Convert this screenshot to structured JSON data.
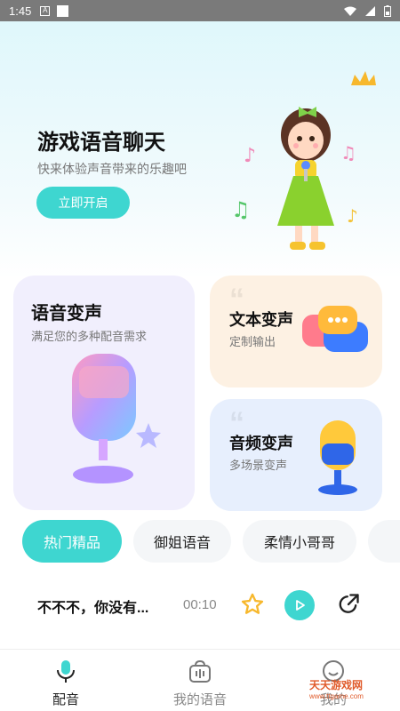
{
  "status_bar": {
    "time": "1:45"
  },
  "hero": {
    "title": "游戏语音聊天",
    "subtitle": "快来体验声音带来的乐趣吧",
    "button_label": "立即开启"
  },
  "cards": [
    {
      "title": "语音变声",
      "subtitle": "满足您的多种配音需求"
    },
    {
      "title": "文本变声",
      "subtitle": "定制输出"
    },
    {
      "title": "音频变声",
      "subtitle": "多场景变声"
    }
  ],
  "tabs": [
    {
      "label": "热门精品",
      "active": true
    },
    {
      "label": "御姐语音",
      "active": false
    },
    {
      "label": "柔情小哥哥",
      "active": false
    }
  ],
  "list": [
    {
      "title": "不不不，你没有...",
      "duration": "00:10"
    }
  ],
  "bottom_nav": [
    {
      "label": "配音",
      "icon": "microphone-icon",
      "active": true
    },
    {
      "label": "我的语音",
      "icon": "voice-bag-icon",
      "active": false
    },
    {
      "label": "我的",
      "icon": "smile-icon",
      "active": false
    }
  ],
  "watermark": {
    "text": "天天游戏网",
    "url": "www.ttgame.com"
  },
  "colors": {
    "accent": "#3ed6d0",
    "star": "#f7b82d"
  }
}
